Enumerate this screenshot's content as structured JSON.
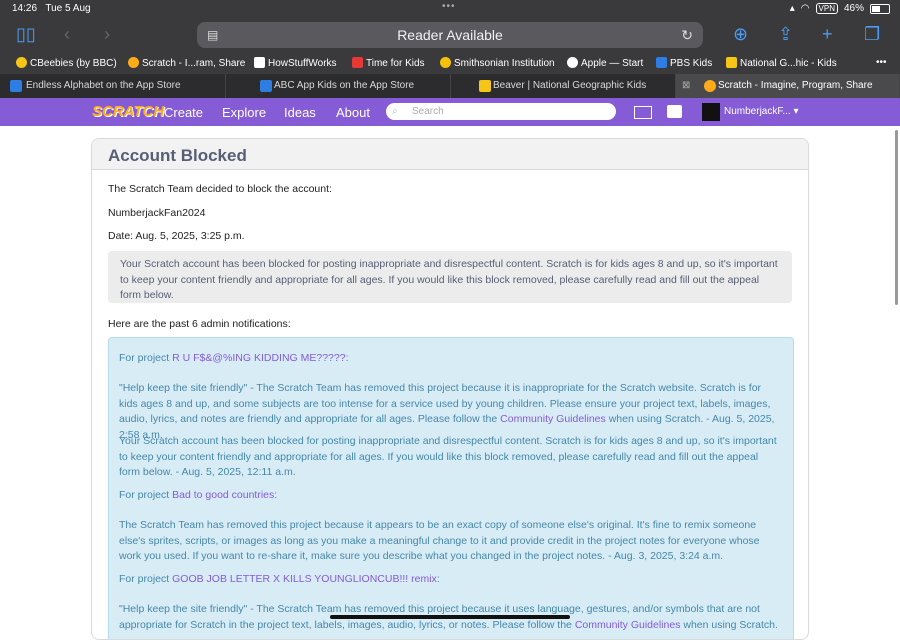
{
  "status": {
    "time": "14:26",
    "date": "Tue 5 Aug",
    "vpn": "VPN",
    "battery": "46%"
  },
  "toolbar": {
    "address": "Reader Available"
  },
  "bookmarks": [
    {
      "label": "CBeebies (by BBC)",
      "color": "#f5c518"
    },
    {
      "label": "Scratch - I...ram, Share",
      "color": "#ffab19"
    },
    {
      "label": "HowStuffWorks",
      "color": "#ffffff"
    },
    {
      "label": "Time for Kids",
      "color": "#e53935"
    },
    {
      "label": "Smithsonian Institution",
      "color": "#f4c20d"
    },
    {
      "label": "Apple — Start",
      "color": "#ffffff"
    },
    {
      "label": "PBS Kids",
      "color": "#2e7de1"
    },
    {
      "label": "National G...hic - Kids",
      "color": "#f5c518"
    }
  ],
  "tabs": [
    {
      "label": "Endless Alphabet on the App Store",
      "color": "#2e7de1"
    },
    {
      "label": "ABC App Kids on the App Store",
      "color": "#2e7de1"
    },
    {
      "label": "Beaver | National Geographic Kids",
      "color": "#f5c518"
    },
    {
      "label": "Scratch - Imagine, Program, Share",
      "color": "#ffab19"
    }
  ],
  "scratch_nav": {
    "logo": "SCRATCH",
    "create": "Create",
    "explore": "Explore",
    "ideas": "Ideas",
    "about": "About",
    "search_placeholder": "Search",
    "username": "NumberjackF...",
    "accent": "#855cd6"
  },
  "card": {
    "title": "Account Blocked",
    "intro": "The Scratch Team decided to block the account:",
    "account": "NumberjackFan2024",
    "date": "Date: Aug. 5, 2025, 3:25 p.m.",
    "notice": "Your Scratch account has been blocked for posting inappropriate and disrespectful content. Scratch is for kids ages 8 and up, so it's important to keep your content friendly and appropriate for all ages. If you would like this block removed, please carefully read and fill out the appeal form below.",
    "past_heading": "Here are the past 6 admin notifications:",
    "n1_prefix": "For project ",
    "n1_project": "R U F$&@%ING KIDDING ME?????",
    "n1_suffix": ":",
    "n1_body_a": "\"Help keep the site friendly\" - The Scratch Team has removed this project because it is inappropriate for the Scratch website. Scratch is for kids ages 8 and up, and some subjects are too intense for a service used by young children. Please ensure your project text, labels, images, audio, lyrics, and notes are friendly and appropriate for all ages. Please follow the ",
    "n1_link": "Community Guidelines",
    "n1_body_b": " when using Scratch. - Aug. 5, 2025, 2:58 a.m.",
    "n2_body": "Your Scratch account has been blocked for posting inappropriate and disrespectful content. Scratch is for kids ages 8 and up, so it's important to keep your content friendly and appropriate for all ages. If you would like this block removed, please carefully read and fill out the appeal form below. - Aug. 5, 2025, 12:11 a.m.",
    "n3_prefix": "For project ",
    "n3_project": "Bad to good countries",
    "n3_suffix": ":",
    "n3_body": "The Scratch Team has removed this project because it appears to be an exact copy of someone else's original. It's fine to remix someone else's sprites, scripts, or images as long as you make a meaningful change to it and provide credit in the project notes for everyone whose work you used. If you want to re-share it, make sure you describe what you changed in the project notes. - Aug. 3, 2025, 3:24 a.m.",
    "n4_prefix": "For project ",
    "n4_project": "GOOB JOB LETTER X KILLS YOUNGLIONCUB!!! remix",
    "n4_suffix": ":",
    "n4_body_a": "\"Help keep the site friendly\" - The Scratch Team has removed this project because it uses language, gestures, and/or symbols that are not appropriate for Scratch in the project text, labels, images, audio, lyrics, or notes. Please follow the ",
    "n4_link": "Community Guidelines",
    "n4_body_b": " when using Scratch. -"
  }
}
